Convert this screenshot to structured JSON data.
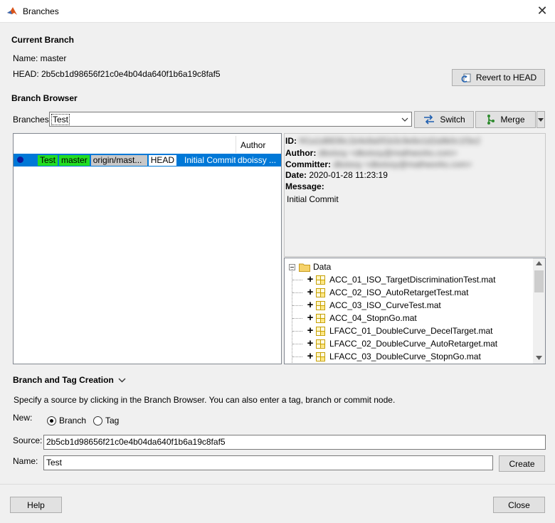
{
  "window": {
    "title": "Branches"
  },
  "current_branch": {
    "heading": "Current Branch",
    "name_line": "Name: master",
    "head_line": "HEAD: 2b5cb1d98656f21c0e4b04da640f1b6a19c8faf5",
    "revert_label": "Revert to HEAD"
  },
  "branch_browser": {
    "heading": "Branch Browser",
    "branches_label": "Branches:",
    "selected_branch": "Test",
    "switch_label": "Switch",
    "merge_label": "Merge",
    "author_header": "Author",
    "commit": {
      "tags": [
        "Test",
        "master",
        "origin/mast...",
        "HEAD"
      ],
      "message": "Initial Commit",
      "author": "dboissy ..."
    },
    "details": {
      "id_label": "ID:",
      "id_value": "f41a1d8836c1b4e8a0f1b3c9e6e1d2a9b0c1f3e2",
      "author_label": "Author:",
      "author_value": "dboissy <dboissy@mathworks.com>",
      "committer_label": "Committer:",
      "committer_value": "dboissy <dboissy@mathworks.com>",
      "date_label": "Date:",
      "date_value": "2020-01-28 11:23:19",
      "message_label": "Message:",
      "message_value": "Initial Commit"
    },
    "tree": {
      "root": "Data",
      "files": [
        "ACC_01_ISO_TargetDiscriminationTest.mat",
        "ACC_02_ISO_AutoRetargetTest.mat",
        "ACC_03_ISO_CurveTest.mat",
        "ACC_04_StopnGo.mat",
        "LFACC_01_DoubleCurve_DecelTarget.mat",
        "LFACC_02_DoubleCurve_AutoRetarget.mat",
        "LFACC_03_DoubleCurve_StopnGo.mat"
      ]
    }
  },
  "creation": {
    "heading": "Branch and Tag Creation",
    "hint": "Specify a source by clicking in the Branch Browser. You can also enter a tag, branch or commit node.",
    "new_label": "New:",
    "branch_option": "Branch",
    "tag_option": "Tag",
    "source_label": "Source:",
    "source_value": "2b5cb1d98656f21c0e4b04da640f1b6a19c8faf5",
    "name_label": "Name:",
    "name_value": "Test",
    "create_label": "Create"
  },
  "footer": {
    "help_label": "Help",
    "close_label": "Close"
  },
  "colors": {
    "selection": "#0078d7",
    "tag_green": "#22dd22",
    "tag_gray": "#c8c8c8"
  }
}
